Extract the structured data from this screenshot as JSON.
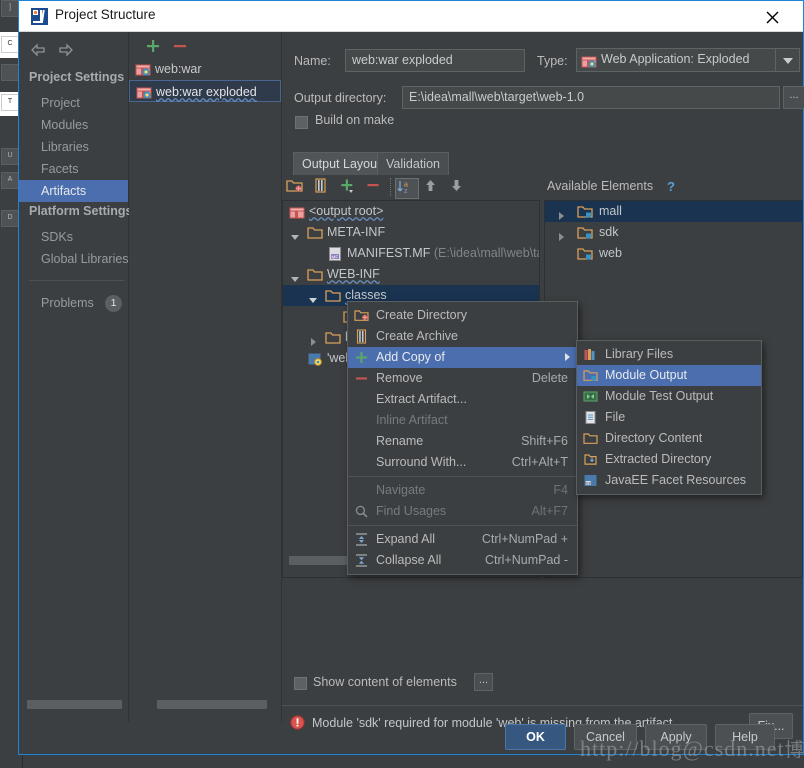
{
  "window": {
    "title": "Project Structure",
    "close_icon": "close-icon",
    "app_icon": "intellij-idea-icon"
  },
  "sidebar": {
    "back_icon": "arrow-left-icon",
    "forward_icon": "arrow-right-icon",
    "groups": [
      {
        "label": "Project Settings"
      },
      {
        "label": "Platform Settings"
      }
    ],
    "items": [
      {
        "label": "Project",
        "selected": false
      },
      {
        "label": "Modules",
        "selected": false
      },
      {
        "label": "Libraries",
        "selected": false
      },
      {
        "label": "Facets",
        "selected": false
      },
      {
        "label": "Artifacts",
        "selected": true
      },
      {
        "label": "SDKs",
        "selected": false
      },
      {
        "label": "Global Libraries",
        "selected": false
      }
    ],
    "problems": {
      "label": "Problems",
      "count": "1"
    }
  },
  "artifacts_panel": {
    "add_icon": "plus-icon",
    "remove_icon": "minus-icon",
    "items": [
      {
        "label": "web:war",
        "icon": "artifact-icon",
        "selected": false
      },
      {
        "label": "web:war exploded",
        "icon": "artifact-icon",
        "selected": true
      }
    ]
  },
  "details": {
    "name_label": "Name:",
    "name_value": "web:war exploded",
    "type_label": "Type:",
    "type_value": "Web Application: Exploded",
    "type_icon": "artifact-icon",
    "output_dir_label": "Output directory:",
    "output_dir_value": "E:\\idea\\mall\\web\\target\\web-1.0",
    "browse_label": "...",
    "build_on_make_label": "Build on make",
    "build_on_make_checked": false,
    "tabs": [
      {
        "label": "Output Layout",
        "active": true
      },
      {
        "label": "Validation",
        "active": false
      }
    ]
  },
  "layout_toolbar": {
    "buttons": [
      {
        "name": "create-directory-icon",
        "title": "Create Directory"
      },
      {
        "name": "create-archive-icon",
        "title": "Create Archive"
      },
      {
        "name": "add-icon",
        "title": "Add"
      },
      {
        "name": "remove-icon",
        "title": "Remove"
      },
      {
        "name": "sort-az-icon",
        "title": "Sort by Name",
        "pressed": true
      },
      {
        "name": "move-up-icon",
        "title": "Move Up"
      },
      {
        "name": "move-down-icon",
        "title": "Move Down"
      }
    ],
    "available_elements_label": "Available Elements",
    "help_label": "?"
  },
  "output_tree": {
    "rows": [
      {
        "label": "<output root>",
        "icon": "artifact-icon",
        "indent": 0,
        "twisty": "none",
        "wavy": true,
        "selected": false
      },
      {
        "label": "META-INF",
        "icon": "folder-icon",
        "indent": 1,
        "twisty": "open",
        "selected": false
      },
      {
        "label": "MANIFEST.MF",
        "sub": "(E:\\idea\\mall\\web\\ta",
        "icon": "manifest-icon",
        "indent": 2,
        "twisty": "none",
        "selected": false
      },
      {
        "label": "WEB-INF",
        "icon": "folder-icon",
        "indent": 1,
        "twisty": "open",
        "wavy": true,
        "selected": false
      },
      {
        "label": "classes",
        "icon": "folder-icon",
        "indent": 2,
        "twisty": "open",
        "wavy": true,
        "selected": true
      },
      {
        "label": "",
        "icon": "module-output-icon",
        "indent": 3,
        "twisty": "none",
        "selected": false
      },
      {
        "label": "lib",
        "icon": "folder-icon",
        "indent": 2,
        "twisty": "closed",
        "selected": false
      },
      {
        "label": "'web' m",
        "icon": "facet-icon",
        "indent": 1,
        "twisty": "none",
        "selected": false
      }
    ]
  },
  "available_tree": {
    "rows": [
      {
        "label": "mall",
        "icon": "module-icon",
        "twisty": "closed",
        "selected": true
      },
      {
        "label": "sdk",
        "icon": "module-icon",
        "twisty": "closed",
        "selected": false
      },
      {
        "label": "web",
        "icon": "module-icon",
        "twisty": "none",
        "selected": false
      }
    ]
  },
  "context_menu": {
    "items": [
      {
        "label": "Create Directory",
        "shortcut": "",
        "icon": "create-directory-icon",
        "state": "normal"
      },
      {
        "label": "Create Archive",
        "shortcut": "",
        "icon": "create-archive-icon",
        "state": "normal"
      },
      {
        "label": "Add Copy of",
        "shortcut": "",
        "icon": "plus-icon",
        "state": "highlighted",
        "submenu": true
      },
      {
        "label": "Remove",
        "shortcut": "Delete",
        "icon": "minus-icon",
        "state": "normal"
      },
      {
        "label": "Extract Artifact...",
        "shortcut": "",
        "icon": "",
        "state": "normal"
      },
      {
        "label": "Inline Artifact",
        "shortcut": "",
        "icon": "",
        "state": "disabled"
      },
      {
        "label": "Rename",
        "shortcut": "Shift+F6",
        "icon": "",
        "state": "normal"
      },
      {
        "label": "Surround With...",
        "shortcut": "Ctrl+Alt+T",
        "icon": "",
        "state": "normal"
      },
      {
        "separator": true
      },
      {
        "label": "Navigate",
        "shortcut": "F4",
        "icon": "",
        "state": "disabled"
      },
      {
        "label": "Find Usages",
        "shortcut": "Alt+F7",
        "icon": "search-icon",
        "state": "disabled"
      },
      {
        "separator": true
      },
      {
        "label": "Expand All",
        "shortcut": "Ctrl+NumPad +",
        "icon": "expand-all-icon",
        "state": "normal"
      },
      {
        "label": "Collapse All",
        "shortcut": "Ctrl+NumPad -",
        "icon": "collapse-all-icon",
        "state": "normal"
      }
    ]
  },
  "submenu": {
    "items": [
      {
        "label": "Library Files",
        "icon": "library-icon",
        "selected": false
      },
      {
        "label": "Module Output",
        "icon": "module-output-icon",
        "selected": true
      },
      {
        "label": "Module Test Output",
        "icon": "module-test-output-icon",
        "selected": false
      },
      {
        "label": "File",
        "icon": "file-icon",
        "selected": false
      },
      {
        "label": "Directory Content",
        "icon": "folder-icon",
        "selected": false
      },
      {
        "label": "Extracted Directory",
        "icon": "extracted-directory-icon",
        "selected": false
      },
      {
        "label": "JavaEE Facet Resources",
        "icon": "javaee-facet-icon",
        "selected": false
      }
    ]
  },
  "footer": {
    "show_content_label": "Show content of elements",
    "show_content_checked": false,
    "show_content_dots": "...",
    "error_icon": "error-icon",
    "error_text": "Module 'sdk' required for module 'web' is missing from the artifact",
    "fix_label": "Fix...",
    "buttons": [
      {
        "label": "OK",
        "primary": true
      },
      {
        "label": "Cancel",
        "primary": false
      },
      {
        "label": "Apply",
        "primary": false
      },
      {
        "label": "Help",
        "primary": false
      }
    ]
  },
  "watermark": {
    "text_ascii": "http://blog@csdn.net",
    "text_cjk": "博客"
  },
  "colors": {
    "accent_blue": "#4b6eaf",
    "selection_dark": "#193351",
    "dialog_bg": "#3c3f41",
    "border_blue": "#1d84d6",
    "error_red": "#d9534f",
    "primary_btn": "#365880"
  }
}
